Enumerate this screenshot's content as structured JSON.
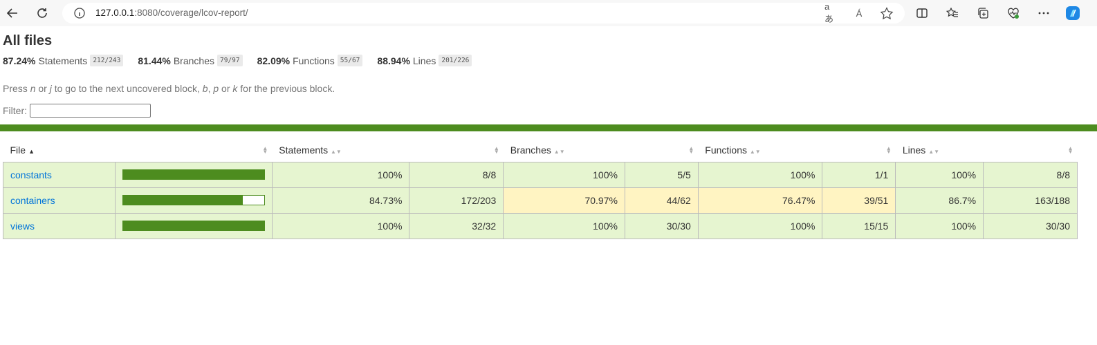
{
  "browser": {
    "url_host": "127.0.0.1",
    "url_rest": ":8080/coverage/lcov-report/",
    "read_aloud_icon": "Á",
    "translate_icon": "aあ"
  },
  "page": {
    "title": "All files",
    "summary": [
      {
        "pct": "87.24%",
        "label": "Statements",
        "frac": "212/243"
      },
      {
        "pct": "81.44%",
        "label": "Branches",
        "frac": "79/97"
      },
      {
        "pct": "82.09%",
        "label": "Functions",
        "frac": "55/67"
      },
      {
        "pct": "88.94%",
        "label": "Lines",
        "frac": "201/226"
      }
    ],
    "hint": {
      "p1": "Press ",
      "k1": "n",
      "p2": " or ",
      "k2": "j",
      "p3": " to go to the next uncovered block, ",
      "k3": "b",
      "p4": ", ",
      "k4": "p",
      "p5": " or ",
      "k5": "k",
      "p6": " for the previous block."
    },
    "filter_label": "Filter:",
    "filter_value": ""
  },
  "table": {
    "headers": {
      "file": "File",
      "statements": "Statements",
      "branches": "Branches",
      "functions": "Functions",
      "lines": "Lines"
    },
    "sort_arrow": "▲",
    "rows": [
      {
        "file": "constants",
        "coverage": 1.0,
        "s_pct": "100%",
        "s_frac": "8/8",
        "b_pct": "100%",
        "b_frac": "5/5",
        "f_pct": "100%",
        "f_frac": "1/1",
        "l_pct": "100%",
        "l_frac": "8/8"
      },
      {
        "file": "containers",
        "coverage": 0.8473,
        "s_pct": "84.73%",
        "s_frac": "172/203",
        "b_pct": "70.97%",
        "b_frac": "44/62",
        "f_pct": "76.47%",
        "f_frac": "39/51",
        "l_pct": "86.7%",
        "l_frac": "163/188"
      },
      {
        "file": "views",
        "coverage": 1.0,
        "s_pct": "100%",
        "s_frac": "32/32",
        "b_pct": "100%",
        "b_frac": "30/30",
        "f_pct": "100%",
        "f_frac": "15/15",
        "l_pct": "100%",
        "l_frac": "30/30"
      }
    ]
  }
}
